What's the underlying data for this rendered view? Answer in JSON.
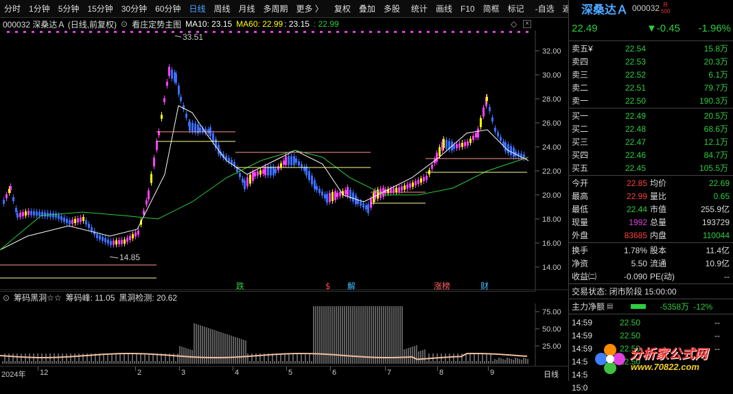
{
  "toolbar": {
    "items": [
      "分时",
      "1分钟",
      "5分钟",
      "15分钟",
      "30分钟",
      "60分钟",
      "日线",
      "周线",
      "月线",
      "多周期",
      "更多 〉",
      "复权",
      "叠加",
      "多股",
      "统计",
      "画线",
      "F10",
      "简框",
      "标记",
      "-自选",
      "返回"
    ],
    "active": "日线"
  },
  "infobar": {
    "code_name": "000032 深桑达Ａ (日线,前复权)",
    "template": "看庄定势主图",
    "ma10": "MA10: 23.15",
    "ma60": "MA60: 22.99",
    "ma_extra1": ": 23.15",
    "ma_extra2": ": 22.99"
  },
  "chart": {
    "y_ticks": [
      "32.00",
      "30.00",
      "28.00",
      "26.00",
      "24.00",
      "22.00",
      "20.00",
      "18.00",
      "16.00",
      "14.00"
    ],
    "high_label": "33.51",
    "low_label": "14.85",
    "markers": [
      {
        "text": "跌",
        "color": "#2ecc40"
      },
      {
        "text": "$",
        "color": "#ff4040"
      },
      {
        "text": "解",
        "color": "#40c0ff"
      },
      {
        "text": "涨榜",
        "color": "#ff6060"
      },
      {
        "text": "财",
        "color": "#40c0ff"
      }
    ]
  },
  "indicator": {
    "name": "筹码黑洞☆☆",
    "peak": "筹码峰: 11.05",
    "detect": "黑洞检测: 20.62",
    "y_ticks": [
      "75.00",
      "50.00",
      "25.00"
    ]
  },
  "dateaxis": {
    "labels": [
      "2024年",
      "12",
      "2",
      "3",
      "4",
      "5",
      "6",
      "7",
      "8",
      "9"
    ],
    "period": "日线"
  },
  "panel": {
    "name": "深桑达Ａ",
    "code": "000032",
    "badge_r": "R",
    "badge_num": "500",
    "price": "22.49",
    "change": "▼-0.45",
    "pct": "-1.96%",
    "sells": [
      {
        "label": "卖五",
        "price": "22.54",
        "vol": "15.8万",
        "note": "¥"
      },
      {
        "label": "卖四",
        "price": "22.53",
        "vol": "20.3万",
        "note": ""
      },
      {
        "label": "卖三",
        "price": "22.52",
        "vol": "6.1万",
        "note": ""
      },
      {
        "label": "卖二",
        "price": "22.51",
        "vol": "79.7万",
        "note": ""
      },
      {
        "label": "卖一",
        "price": "22.50",
        "vol": "190.3万",
        "note": ""
      }
    ],
    "buys": [
      {
        "label": "买一",
        "price": "22.49",
        "vol": "20.5万"
      },
      {
        "label": "买二",
        "price": "22.48",
        "vol": "68.6万"
      },
      {
        "label": "买三",
        "price": "22.47",
        "vol": "12.1万"
      },
      {
        "label": "买四",
        "price": "22.46",
        "vol": "84.7万"
      },
      {
        "label": "买五",
        "price": "22.45",
        "vol": "105.5万"
      }
    ],
    "stats": [
      {
        "l1": "今开",
        "v1": "22.85",
        "c1": "red",
        "l2": "均价",
        "v2": "22.69",
        "c2": "green"
      },
      {
        "l1": "最高",
        "v1": "22.99",
        "c1": "red",
        "l2": "量比",
        "v2": "0.65",
        "c2": "green"
      },
      {
        "l1": "最低",
        "v1": "22.44",
        "c1": "green",
        "l2": "市值",
        "v2": "255.9亿",
        "c2": "white"
      },
      {
        "l1": "现量",
        "v1": "1992",
        "c1": "magenta",
        "l2": "总量",
        "v2": "193729",
        "c2": "white"
      },
      {
        "l1": "外盘",
        "v1": "83685",
        "c1": "red",
        "l2": "内盘",
        "v2": "110044",
        "c2": "green"
      }
    ],
    "stats2": [
      {
        "l1": "换手",
        "v1": "1.78%",
        "l2": "股本",
        "v2": "11.4亿"
      },
      {
        "l1": "净资",
        "v1": "5.50",
        "l2": "流通",
        "v2": "10.9亿"
      },
      {
        "l1": "收益㈡",
        "v1": "-0.090",
        "l2": "PE(动)",
        "v2": "--"
      }
    ],
    "trade_status": "交易状态: 闭市阶段 15:00:00",
    "main_flow_label": "主力净额",
    "main_flow_value": "-5358万",
    "main_flow_pct": "-12%",
    "ticks": [
      {
        "time": "14:59",
        "price": "22.50",
        "vol": "--"
      },
      {
        "time": "14:59",
        "price": "22.50",
        "vol": "--"
      },
      {
        "time": "14:59",
        "price": "22.50",
        "vol": "--"
      },
      {
        "time": "14:5",
        "price": "22.50",
        "vol": ""
      },
      {
        "time": "14:5",
        "price": "",
        "vol": ""
      },
      {
        "time": "15:0",
        "price": "",
        "vol": ""
      }
    ],
    "watermark": "分析家公式网",
    "watermark_url": "www.70822.com"
  }
}
